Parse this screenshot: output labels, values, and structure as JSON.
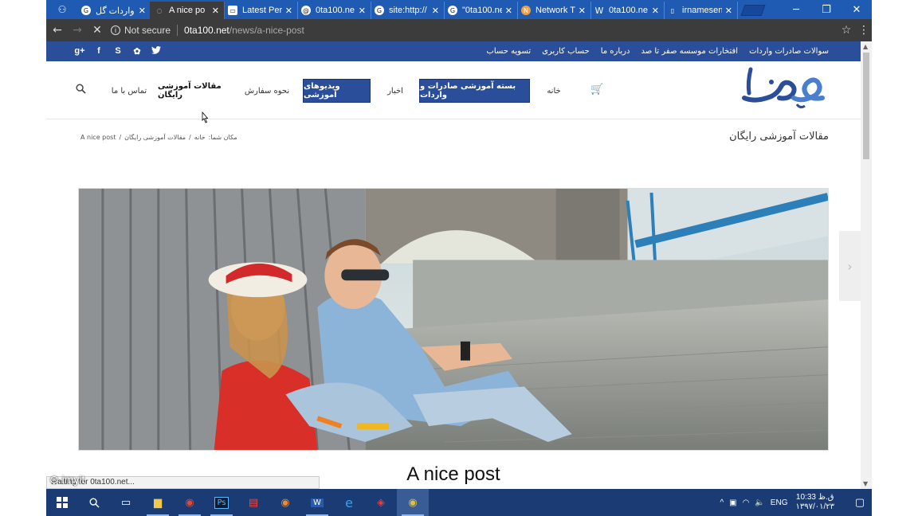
{
  "browser": {
    "tabs": [
      {
        "icon": "google-icon",
        "title": "واردات گل",
        "active": false
      },
      {
        "icon": "loading-icon",
        "title": "A nice po",
        "active": true
      },
      {
        "icon": "monitor-icon",
        "title": "Latest Perl",
        "active": false
      },
      {
        "icon": "at-icon",
        "title": "0ta100.ne",
        "active": false
      },
      {
        "icon": "google-icon",
        "title": "site:http://",
        "active": false
      },
      {
        "icon": "google-icon",
        "title": "\"0ta100.ne",
        "active": false
      },
      {
        "icon": "network-icon",
        "title": "Network T",
        "active": false
      },
      {
        "icon": "wikipedia-icon",
        "title": "0ta100.ne",
        "active": false
      },
      {
        "icon": "page-icon",
        "title": "irnamesen",
        "active": false
      }
    ],
    "security_label": "Not secure",
    "url_host": "0ta100.net",
    "url_path": "/news/a-nice-post"
  },
  "site": {
    "social": [
      "g+",
      "f",
      "S",
      "✿",
      "🐦"
    ],
    "top_links": [
      "سوالات صادرات واردات",
      "افتخارات موسسه صفر تا صد",
      "درباره ما",
      "حساب کاربری",
      "تسویه حساب"
    ],
    "menu": {
      "home": "خانه",
      "package": "بسته آموزشی صادرات و واردات",
      "news": "اخبار",
      "videos": "ویدیوهای آموزشی",
      "how_to_order": "نحوه سفارش",
      "free_articles": "مقالات آموزشی رایگان",
      "contact": "تماس با ما"
    },
    "page_heading": "مقالات آموزشی رایگان",
    "breadcrumb": {
      "prefix": "مکان شما:",
      "home": "خانه",
      "category": "مقالات آموزشی رایگان",
      "current": "A nice post"
    },
    "post_title": "A nice post"
  },
  "status_text": "Waiting for 0ta100.net...",
  "taskbar": {
    "apps": [
      "windows-start",
      "search",
      "task-view",
      "file-explorer",
      "chrome",
      "photoshop",
      "media-app",
      "firefox",
      "word",
      "edge",
      "vivaldi",
      "chrome-active"
    ],
    "lang": "ENG",
    "time": "10:33 ق.ظ",
    "date": "۱۳۹۷/۰۱/۲۳"
  },
  "watermark": "imyit",
  "colors": {
    "brand_blue": "#2b4e9a",
    "tab_strip": "#1f5bb3",
    "taskbar": "#1a3b74"
  }
}
